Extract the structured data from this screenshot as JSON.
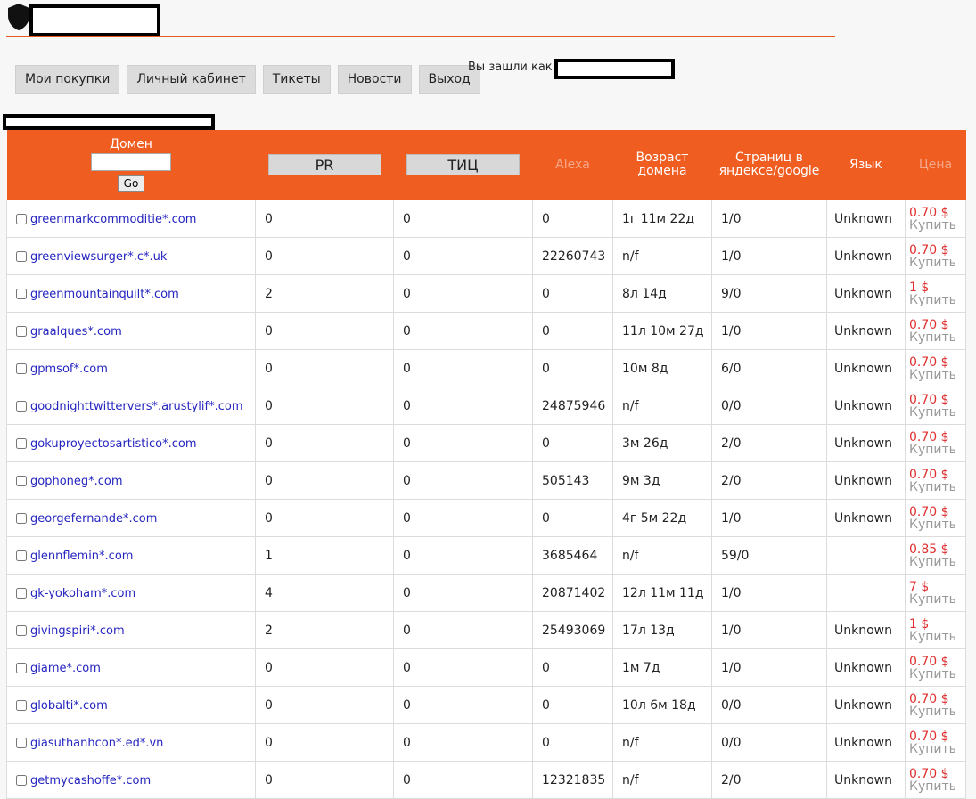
{
  "nav": {
    "buttons": [
      "Мои покупки",
      "Личный кабинет",
      "Тикеты",
      "Новости",
      "Выход"
    ],
    "login_label": "Вы зашли как:"
  },
  "table": {
    "headers": {
      "domain": "Домен",
      "go": "Go",
      "pr": "PR",
      "tic": "ТИЦ",
      "alexa": "Alexa",
      "age_line1": "Возраст",
      "age_line2": "домена",
      "pages_line1": "Страниц в",
      "pages_line2": "яндексе/google",
      "lang": "Язык",
      "price": "Цена"
    },
    "buy_label": "Купить",
    "rows": [
      {
        "domain": "greenmarkcommoditie*.com",
        "pr": "0",
        "tic": "0",
        "alexa": "0",
        "age": "1г 11м 22д",
        "pages": "1/0",
        "lang": "Unknown",
        "price": "0.70 $"
      },
      {
        "domain": "greenviewsurger*.c*.uk",
        "pr": "0",
        "tic": "0",
        "alexa": "22260743",
        "age": "n/f",
        "pages": "1/0",
        "lang": "Unknown",
        "price": "0.70 $"
      },
      {
        "domain": "greenmountainquilt*.com",
        "pr": "2",
        "tic": "0",
        "alexa": "0",
        "age": "8л 14д",
        "pages": "9/0",
        "lang": "Unknown",
        "price": "1 $"
      },
      {
        "domain": "graalques*.com",
        "pr": "0",
        "tic": "0",
        "alexa": "0",
        "age": "11л 10м 27д",
        "pages": "1/0",
        "lang": "Unknown",
        "price": "0.70 $"
      },
      {
        "domain": "gpmsof*.com",
        "pr": "0",
        "tic": "0",
        "alexa": "0",
        "age": "10м 8д",
        "pages": "6/0",
        "lang": "Unknown",
        "price": "0.70 $"
      },
      {
        "domain": "goodnighttwittervers*.arustylif*.com",
        "pr": "0",
        "tic": "0",
        "alexa": "24875946",
        "age": "n/f",
        "pages": "0/0",
        "lang": "Unknown",
        "price": "0.70 $"
      },
      {
        "domain": "gokuproyectosartistico*.com",
        "pr": "0",
        "tic": "0",
        "alexa": "0",
        "age": "3м 26д",
        "pages": "2/0",
        "lang": "Unknown",
        "price": "0.70 $"
      },
      {
        "domain": "gophoneg*.com",
        "pr": "0",
        "tic": "0",
        "alexa": "505143",
        "age": "9м 3д",
        "pages": "2/0",
        "lang": "Unknown",
        "price": "0.70 $"
      },
      {
        "domain": "georgefernande*.com",
        "pr": "0",
        "tic": "0",
        "alexa": "0",
        "age": "4г 5м 22д",
        "pages": "1/0",
        "lang": "Unknown",
        "price": "0.70 $"
      },
      {
        "domain": "glennflemin*.com",
        "pr": "1",
        "tic": "0",
        "alexa": "3685464",
        "age": "n/f",
        "pages": "59/0",
        "lang": "",
        "price": "0.85 $"
      },
      {
        "domain": "gk-yokoham*.com",
        "pr": "4",
        "tic": "0",
        "alexa": "20871402",
        "age": "12л 11м 11д",
        "pages": "1/0",
        "lang": "",
        "price": "7 $"
      },
      {
        "domain": "givingspiri*.com",
        "pr": "2",
        "tic": "0",
        "alexa": "25493069",
        "age": "17л 13д",
        "pages": "1/0",
        "lang": "Unknown",
        "price": "1 $"
      },
      {
        "domain": "giame*.com",
        "pr": "0",
        "tic": "0",
        "alexa": "0",
        "age": "1м 7д",
        "pages": "1/0",
        "lang": "Unknown",
        "price": "0.70 $"
      },
      {
        "domain": "globalti*.com",
        "pr": "0",
        "tic": "0",
        "alexa": "0",
        "age": "10л 6м 18д",
        "pages": "0/0",
        "lang": "Unknown",
        "price": "0.70 $"
      },
      {
        "domain": "giasuthanhcon*.ed*.vn",
        "pr": "0",
        "tic": "0",
        "alexa": "0",
        "age": "n/f",
        "pages": "0/0",
        "lang": "Unknown",
        "price": "0.70 $"
      },
      {
        "domain": "getmycashoffe*.com",
        "pr": "0",
        "tic": "0",
        "alexa": "12321835",
        "age": "n/f",
        "pages": "2/0",
        "lang": "Unknown",
        "price": "0.70 $"
      }
    ]
  }
}
